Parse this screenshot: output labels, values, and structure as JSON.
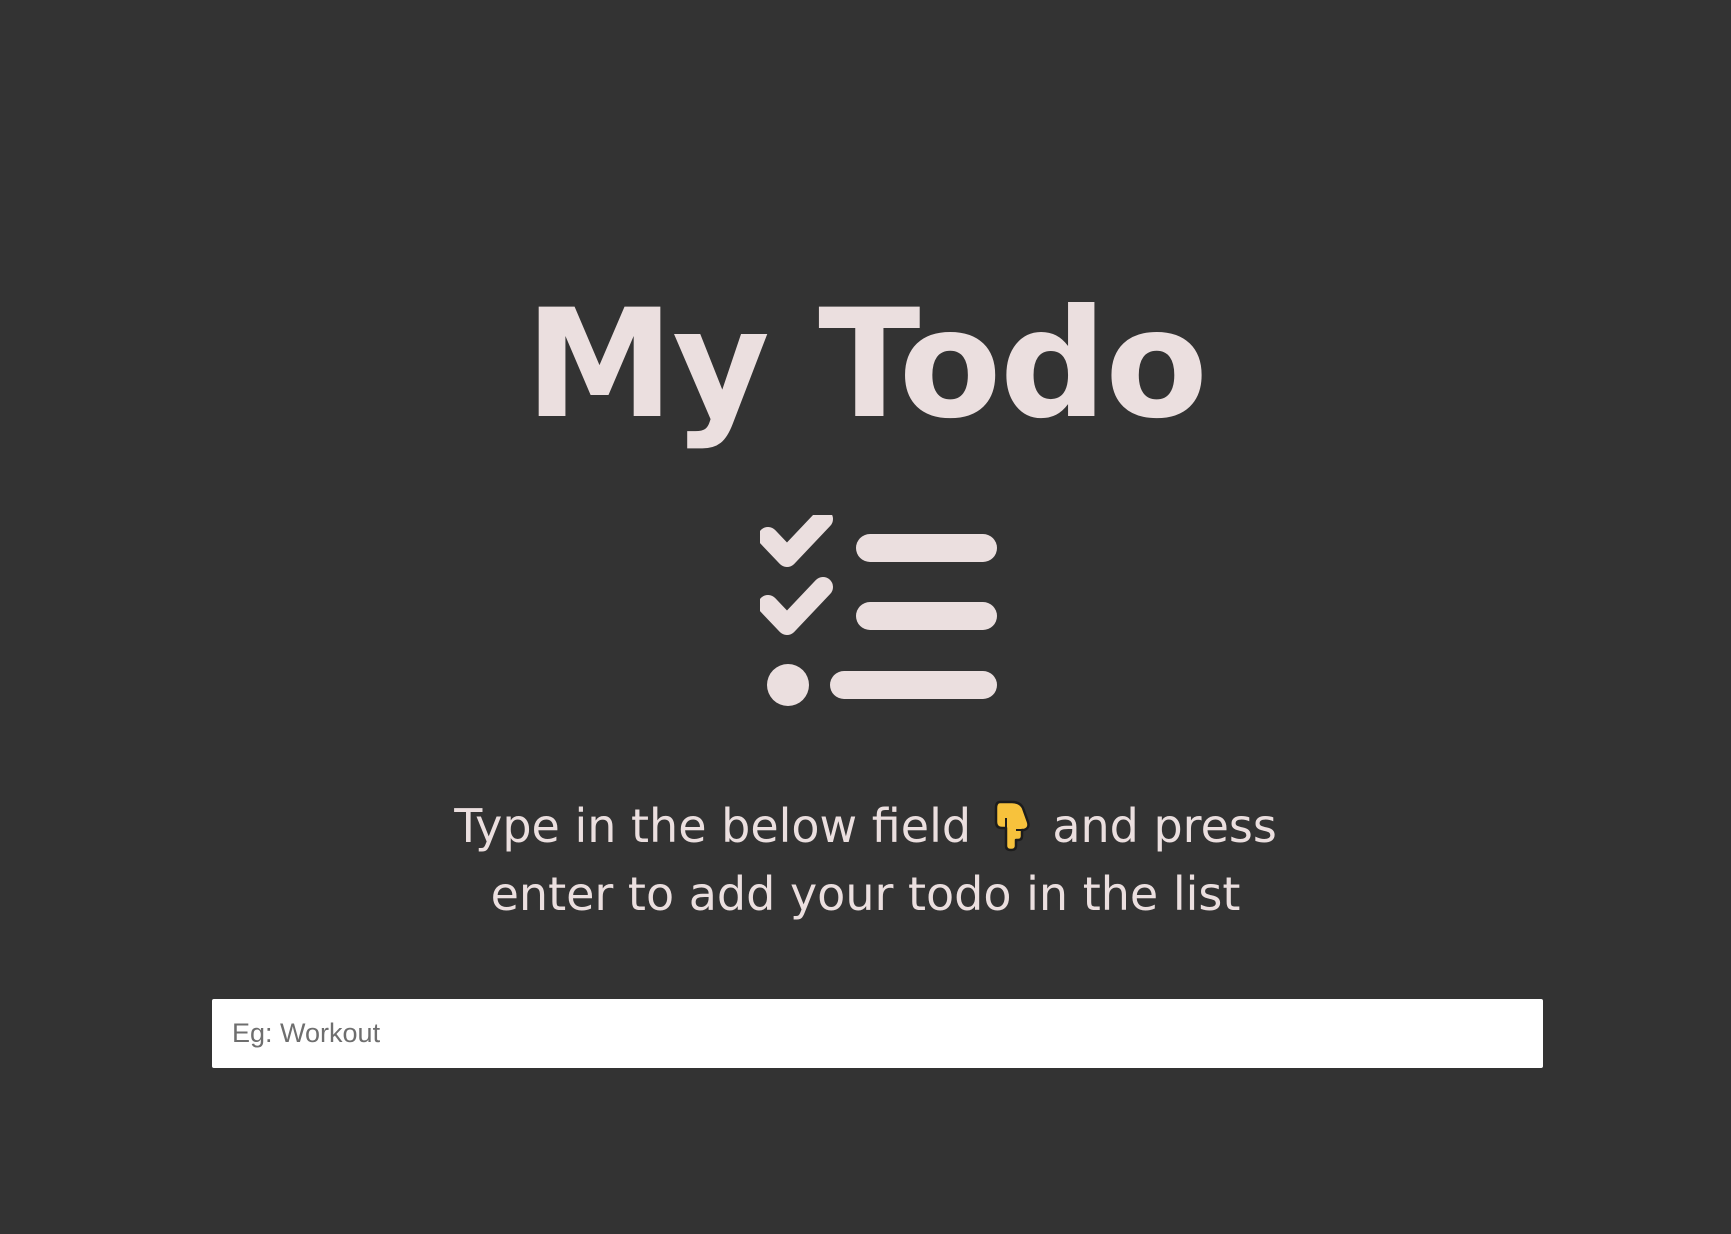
{
  "header": {
    "title": "My Todo"
  },
  "hero_icon": {
    "name": "todo-list-icon",
    "color": "#ebdfdf"
  },
  "instructions": {
    "line1_before": "Type in the below field",
    "line1_emoji": "backhand-index-pointing-down",
    "line1_after": "and press",
    "line2": "enter to add your todo in the list"
  },
  "todo_input": {
    "value": "",
    "placeholder": "Eg: Workout"
  },
  "colors": {
    "background": "#333333",
    "text": "#ebdfdf",
    "input_background": "#ffffff",
    "emoji": "#f7c23c"
  }
}
